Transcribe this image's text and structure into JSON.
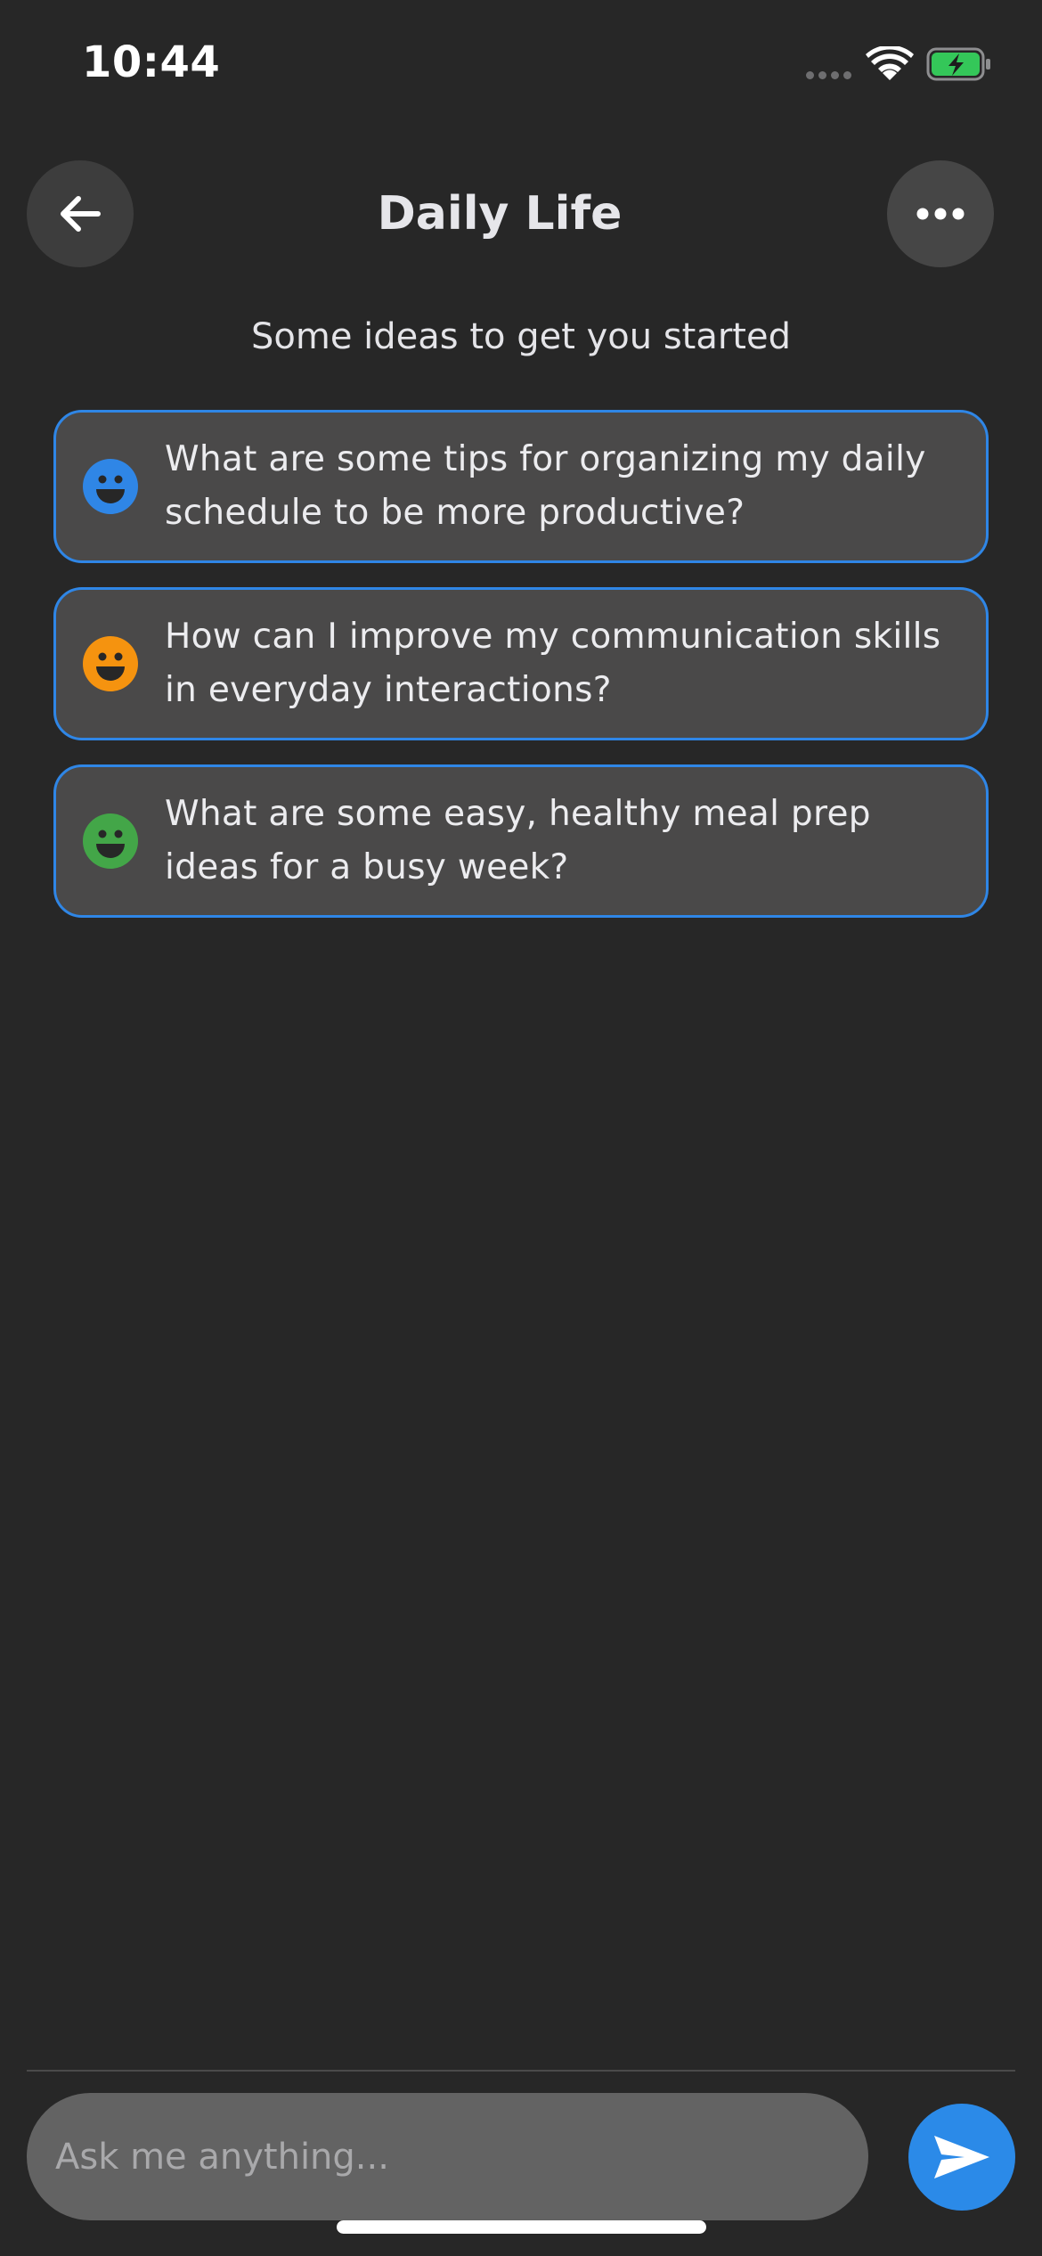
{
  "status_bar": {
    "time": "10:44"
  },
  "header": {
    "title": "Daily Life",
    "back_icon": "arrow-left-icon",
    "more_icon": "ellipsis-icon"
  },
  "subtitle": "Some ideas to get you started",
  "suggestions": [
    {
      "text": "What are some tips for organizing my daily schedule to be more productive?",
      "icon": "smiley-icon",
      "color": "#2f86e6"
    },
    {
      "text": "How can I improve my communication skills in everyday interactions?",
      "icon": "smiley-icon",
      "color": "#f5930f"
    },
    {
      "text": "What are some easy, healthy meal prep ideas for a busy week?",
      "icon": "smiley-icon",
      "color": "#43a648"
    }
  ],
  "composer": {
    "placeholder": "Ask me anything...",
    "send_icon": "send-icon"
  },
  "colors": {
    "accent": "#2b8ae8",
    "background": "#272727",
    "card": "#4a4949",
    "battery": "#34c759"
  }
}
